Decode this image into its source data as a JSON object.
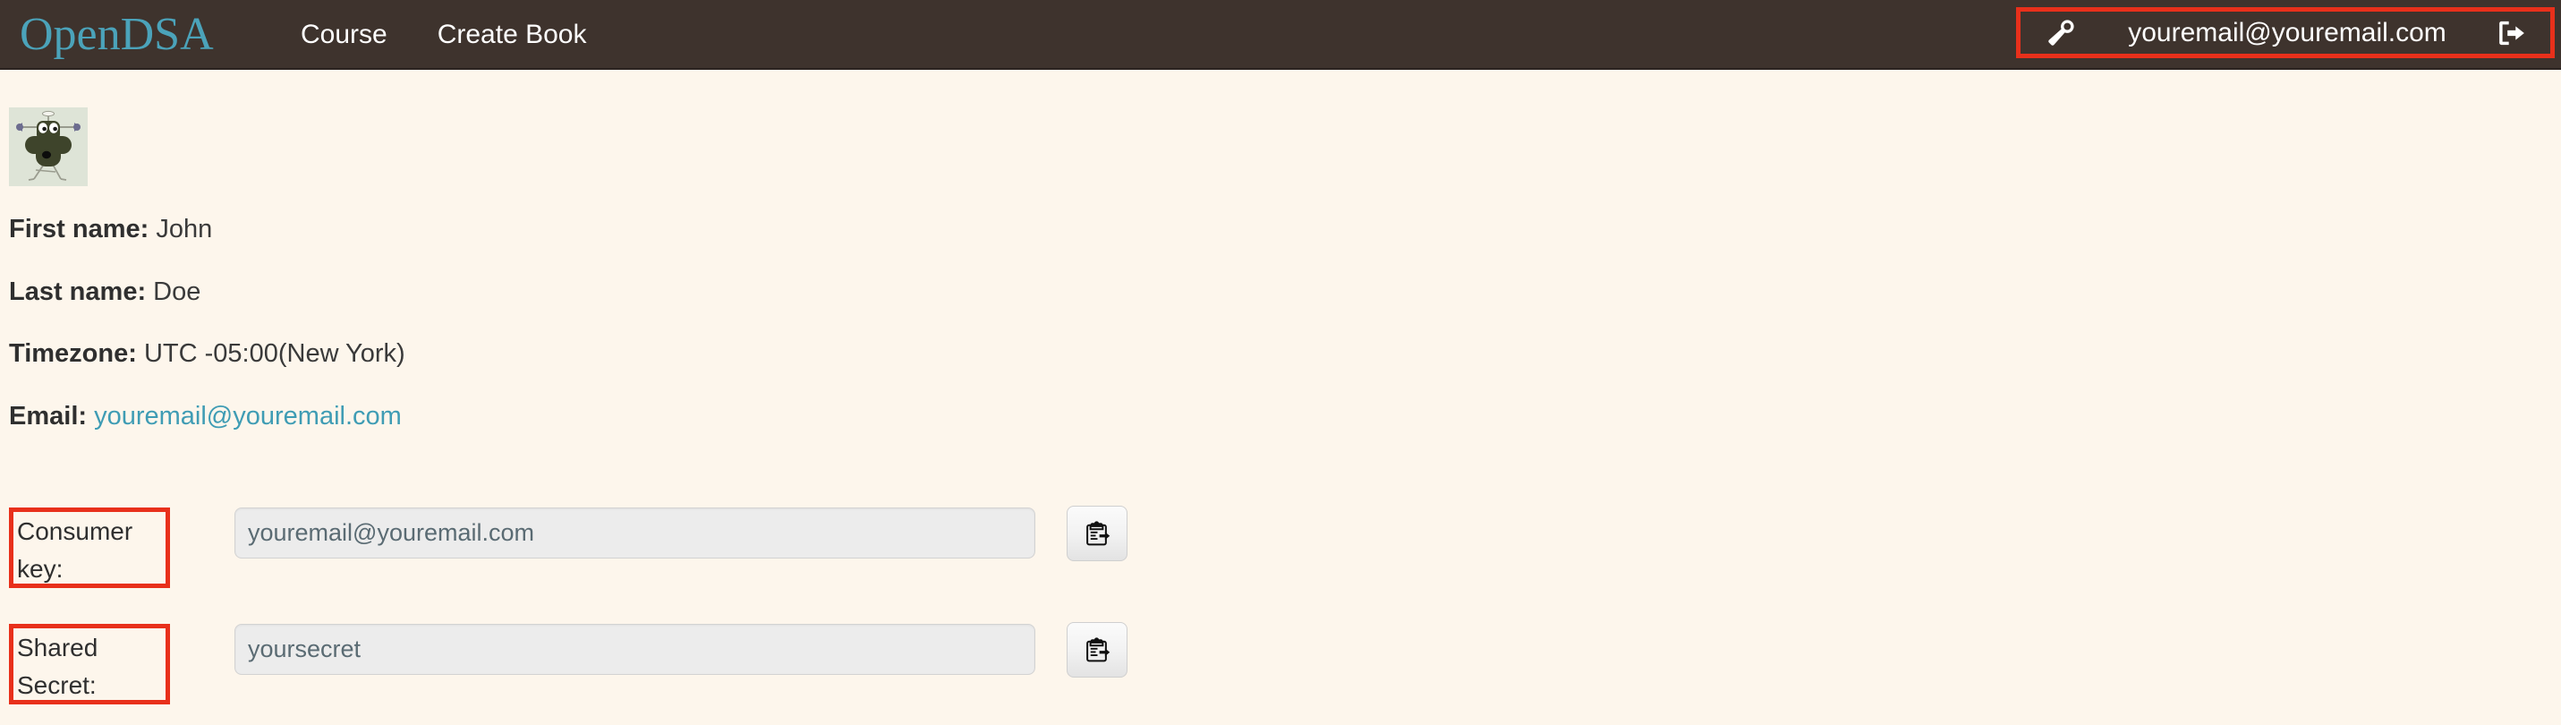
{
  "navbar": {
    "brand": "OpenDSA",
    "links": [
      {
        "label": "Course",
        "name": "nav-link-course"
      },
      {
        "label": "Create Book",
        "name": "nav-link-create-book"
      }
    ],
    "wrench_icon": "wrench-icon",
    "user_email": "youremail@youremail.com",
    "signout_icon": "sign-out-icon",
    "highlight_color": "#E8301B",
    "background_color": "#3E332D",
    "brand_color": "#4BA3BA"
  },
  "profile": {
    "avatar_icon": "identicon-avatar",
    "avatar_background_color": "#DEE4D7",
    "rows": [
      {
        "label": "First name:",
        "value": "John",
        "is_link": false
      },
      {
        "label": "Last name:",
        "value": "Doe",
        "is_link": false
      },
      {
        "label": "Timezone:",
        "value": "UTC -05:00(New York)",
        "is_link": false
      },
      {
        "label": "Email:",
        "value": "youremail@youremail.com",
        "is_link": true
      }
    ],
    "link_color": "#3F9CB4"
  },
  "credentials": [
    {
      "label": "Consumer key:",
      "value": "youremail@youremail.com",
      "placeholder": "Consumer key",
      "copy_icon": "clipboard-paste-icon",
      "copy_title": "Copy to clipboard"
    },
    {
      "label": "Shared Secret:",
      "value": "yoursecret",
      "placeholder": "Shared secret",
      "copy_icon": "clipboard-paste-icon",
      "copy_title": "Copy to clipboard"
    }
  ]
}
